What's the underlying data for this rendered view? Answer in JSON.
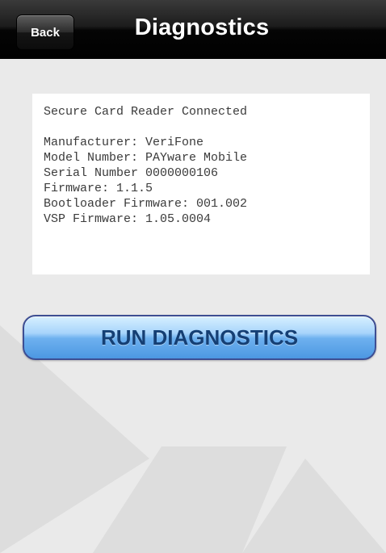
{
  "navbar": {
    "title": "Diagnostics",
    "back_label": "Back"
  },
  "device_info": {
    "status": "Secure Card Reader Connected",
    "lines": [
      "Manufacturer: VeriFone",
      "Model Number: PAYware Mobile",
      "Serial Number 0000000106",
      "Firmware: 1.1.5",
      "Bootloader Firmware: 001.002",
      "VSP Firmware: 1.05.0004"
    ]
  },
  "actions": {
    "run_label": "RUN DIAGNOSTICS"
  },
  "colors": {
    "navbar": "#000000",
    "background": "#eaeaea",
    "button_fill": "#6eb1ef",
    "button_text": "#153f74"
  }
}
